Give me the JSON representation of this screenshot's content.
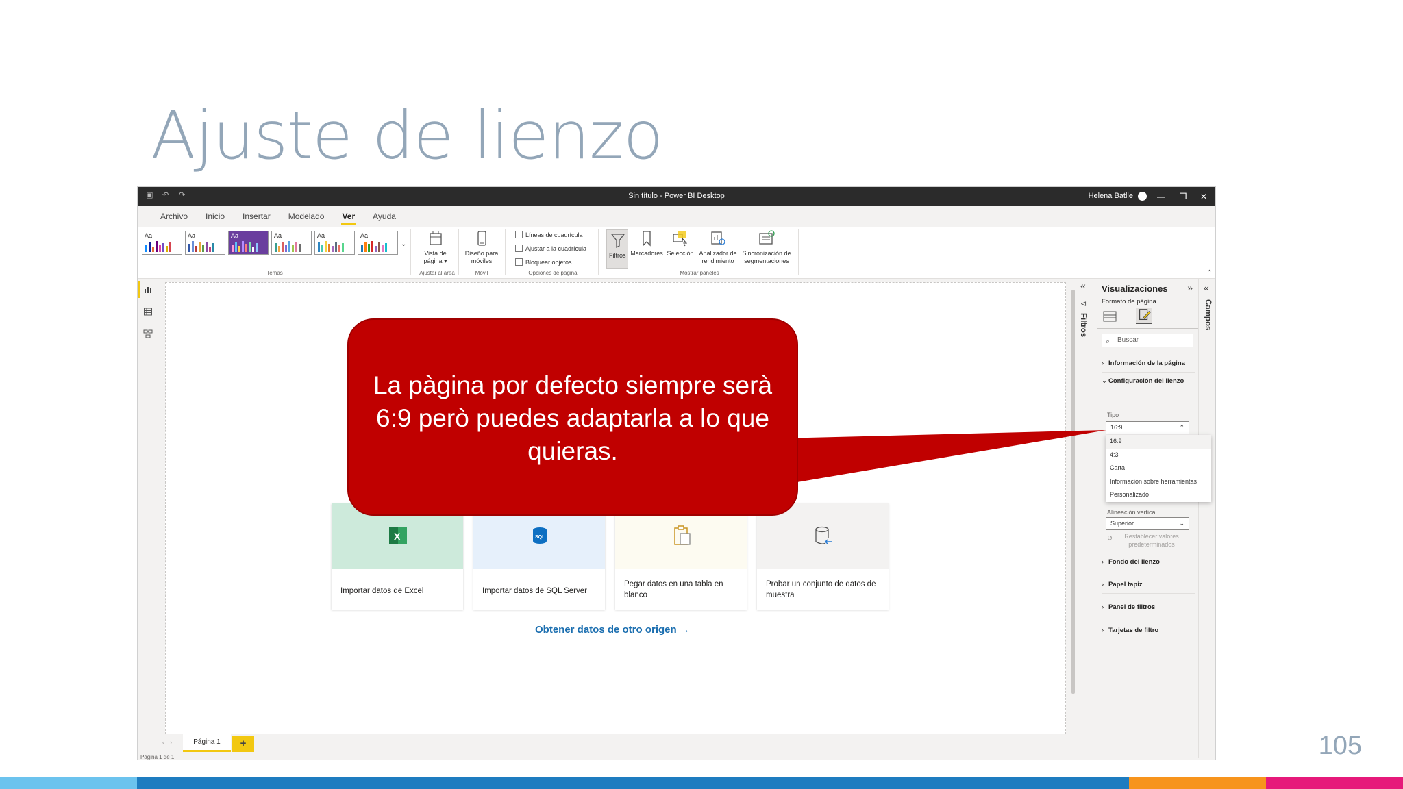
{
  "slide": {
    "title": "Ajuste de lienzo",
    "page_number": "105",
    "bottom_bar_colors": [
      "#6cc3ee",
      "#1e7cc0",
      "#f7941d",
      "#e6197a"
    ]
  },
  "window": {
    "title": "Sin título - Power BI Desktop",
    "user": "Helena Batlle",
    "controls": [
      "minimize-icon",
      "restore-icon",
      "close-icon"
    ]
  },
  "menu": {
    "tabs": [
      "Archivo",
      "Inicio",
      "Insertar",
      "Modelado",
      "Ver",
      "Ayuda"
    ],
    "active": "Ver"
  },
  "ribbon": {
    "theme_label": "Aa",
    "groups": {
      "themes": "Temas",
      "scale": "Ajustar al área",
      "mobile": "Móvil",
      "page_options": "Opciones de página",
      "show_panes": "Mostrar paneles"
    },
    "page_view": "Vista de página ▾",
    "mobile_layout": "Diseño para móviles",
    "checkboxes": [
      "Líneas de cuadrícula",
      "Ajustar a la cuadrícula",
      "Bloquear objetos"
    ],
    "panes": [
      "Filtros",
      "Marcadores",
      "Selección",
      "Analizador de rendimiento",
      "Sincronización de segmentaciones"
    ]
  },
  "welcome": {
    "cards": [
      {
        "label": "Importar datos de Excel",
        "icon": "excel-icon",
        "color": "#cdeadb"
      },
      {
        "label": "Importar datos de SQL Server",
        "icon": "sql-icon",
        "color": "#e6f0fb"
      },
      {
        "label": "Pegar datos en una tabla en blanco",
        "icon": "clipboard-icon",
        "color": "#fdfbf1"
      },
      {
        "label": "Probar un conjunto de datos de muestra",
        "icon": "database-icon",
        "color": "#f3f2f1"
      }
    ],
    "other_source": "Obtener datos de otro origen →"
  },
  "filters_pane": {
    "label": "Filtros"
  },
  "viz_pane": {
    "title": "Visualizaciones",
    "subtitle": "Formato de página",
    "search_placeholder": "Buscar",
    "sections": {
      "page_info": "Información de la página",
      "canvas_settings": "Configuración del lienzo",
      "canvas_background": "Fondo del lienzo",
      "wallpaper": "Papel tapiz",
      "filter_pane": "Panel de filtros",
      "filter_cards": "Tarjetas de filtro"
    },
    "type_label": "Tipo",
    "type_value": "16:9",
    "type_options": [
      "16:9",
      "4:3",
      "Carta",
      "Información sobre herramientas",
      "Personalizado"
    ],
    "vertical_align_label": "Alineación vertical",
    "vertical_align_value": "Superior",
    "reset": "Restablecer valores predeterminados"
  },
  "fields_pane": {
    "label": "Campos"
  },
  "pages": {
    "tab": "Página 1",
    "add": "+",
    "status": "Página 1 de 1"
  },
  "callout": {
    "text": "La pàgina por defecto siempre serà 6:9 però puedes adaptarla a lo que quieras.",
    "color": "#c00000"
  }
}
